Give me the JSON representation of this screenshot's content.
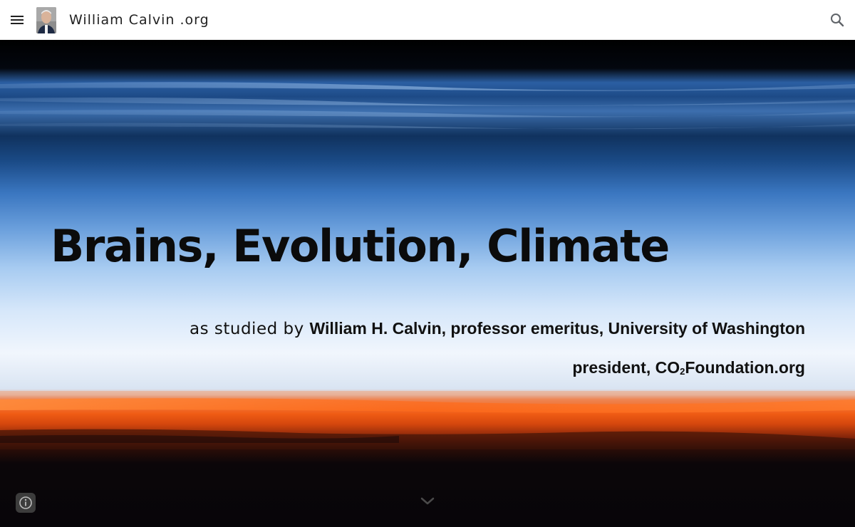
{
  "header": {
    "menu_icon": "hamburger-menu-icon",
    "site_title": "William Calvin .org",
    "search_icon": "search-icon"
  },
  "hero": {
    "title": "Brains, Evolution, Climate",
    "subtitle_prefix": "as studied by ",
    "subtitle_name": "William H. Calvin, professor emeritus, University of Washington",
    "president_prefix": "president, CO",
    "president_subscript": "2",
    "president_suffix": "Foundation.org",
    "scroll_icon": "chevron-down-icon",
    "info_icon": "info-icon"
  },
  "colors": {
    "topbar_background": "#ffffff",
    "title_text": "#212121",
    "hero_text": "#0b0b0b",
    "sky_top": "#000000",
    "sky_blue": "#3a76c0",
    "horizon_white": "#f1f6fd",
    "horizon_orange": "#f05c14",
    "ground_dark": "#070509"
  }
}
